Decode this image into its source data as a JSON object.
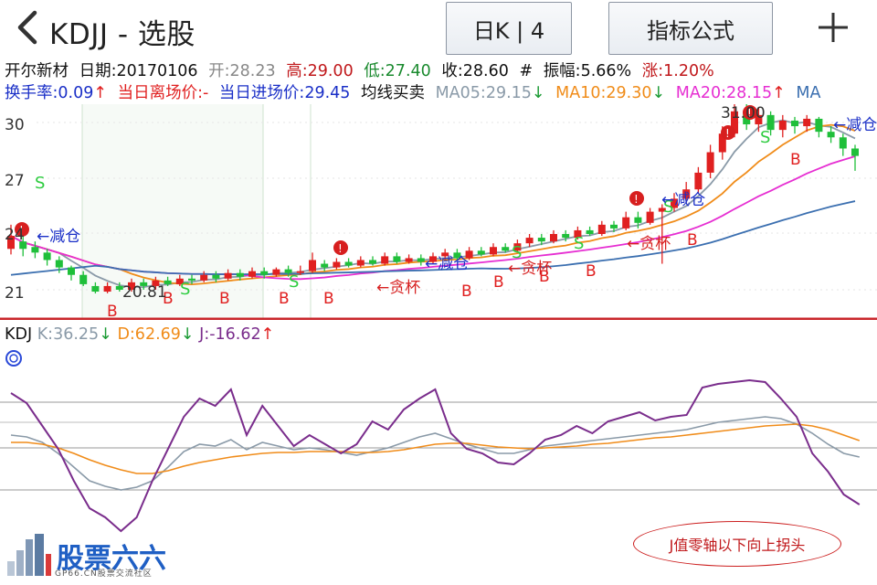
{
  "app": {
    "title": "KDJJ - 选股"
  },
  "toolbar": {
    "period_label": "日K | 4",
    "formula_label": "指标公式"
  },
  "stock": {
    "name": "开尔新材",
    "date": "日期:20170106",
    "open": "开:28.23",
    "high": "高:29.00",
    "low": "低:27.40",
    "close": "收:28.60",
    "amp_prefix": "#",
    "amplitude": "振幅:5.66%",
    "change": "涨:1.20%"
  },
  "indicators": {
    "turnover": "换手率:0.09",
    "exit_price": "当日离场价:-",
    "entry_price": "当日进场价:29.45",
    "strategy": "均线买卖",
    "ma5": "MA05:29.15",
    "ma10": "MA10:29.30",
    "ma20": "MA20:28.15",
    "ma_more": "MA"
  },
  "price_axis": {
    "ticks": [
      "30",
      "27",
      "24",
      "21"
    ]
  },
  "annotations": {
    "low_price": "20.81",
    "high_price": "31.00",
    "reduce": "←减仓",
    "greed": "←贪杯",
    "buy": "B",
    "sell": "S",
    "alert": "!"
  },
  "kdj": {
    "name": "KDJ",
    "k": "K:36.25",
    "d": "D:62.69",
    "j": "J:-16.62"
  },
  "watermark": {
    "brand": "股票六六",
    "site": "GP66.CN股票交流社区"
  },
  "note": "J值零轴以下向上拐头",
  "colors": {
    "up": "#e02020",
    "down": "#1fbf3a",
    "ma5": "#8a9aa8",
    "ma10": "#f08c1a",
    "ma20": "#e62ed2",
    "ma60": "#3b6fb0",
    "k": "#8a9aa8",
    "d": "#f08c1a",
    "j": "#7a2d8c",
    "buy": "#e02020",
    "sell": "#2ecc40",
    "hint": "#1a2fc7"
  },
  "icons": {
    "back": "chevron-left-icon",
    "add": "plus-icon",
    "kdj_marker": "target-circle-icon"
  }
}
